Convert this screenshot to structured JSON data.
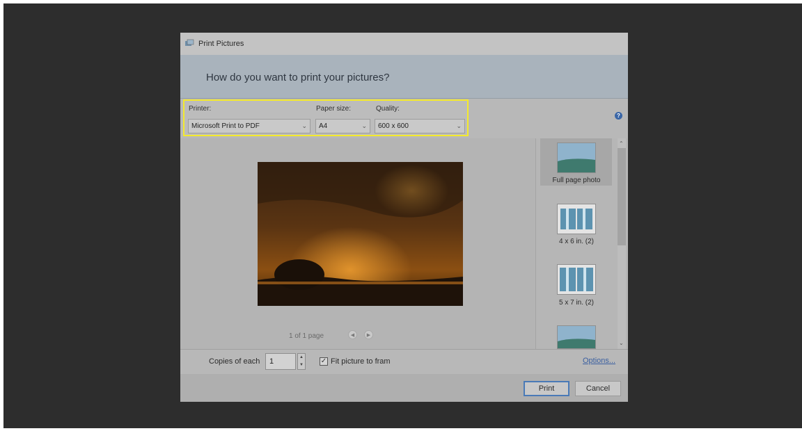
{
  "window": {
    "title": "Print Pictures"
  },
  "header": {
    "question": "How do you want to print your pictures?"
  },
  "printer": {
    "label": "Printer:",
    "value": "Microsoft Print to PDF"
  },
  "paper_size": {
    "label": "Paper size:",
    "value": "A4"
  },
  "quality": {
    "label": "Quality:",
    "value": "600 x 600"
  },
  "preview": {
    "pager_text": "1 of 1 page"
  },
  "layouts": [
    {
      "label": "Full page photo",
      "selected": true
    },
    {
      "label": "4 x 6 in. (2)"
    },
    {
      "label": "5 x 7 in. (2)"
    },
    {
      "label": ""
    }
  ],
  "copies": {
    "label": "Copies of each",
    "value": "1"
  },
  "fit": {
    "label": "Fit picture to fram",
    "checked": true
  },
  "options_link": "Options...",
  "buttons": {
    "print": "Print",
    "cancel": "Cancel"
  },
  "colors": {
    "highlight": "#f4ea2c",
    "link": "#3a5fa0",
    "primary_border": "#4a7ab7"
  }
}
